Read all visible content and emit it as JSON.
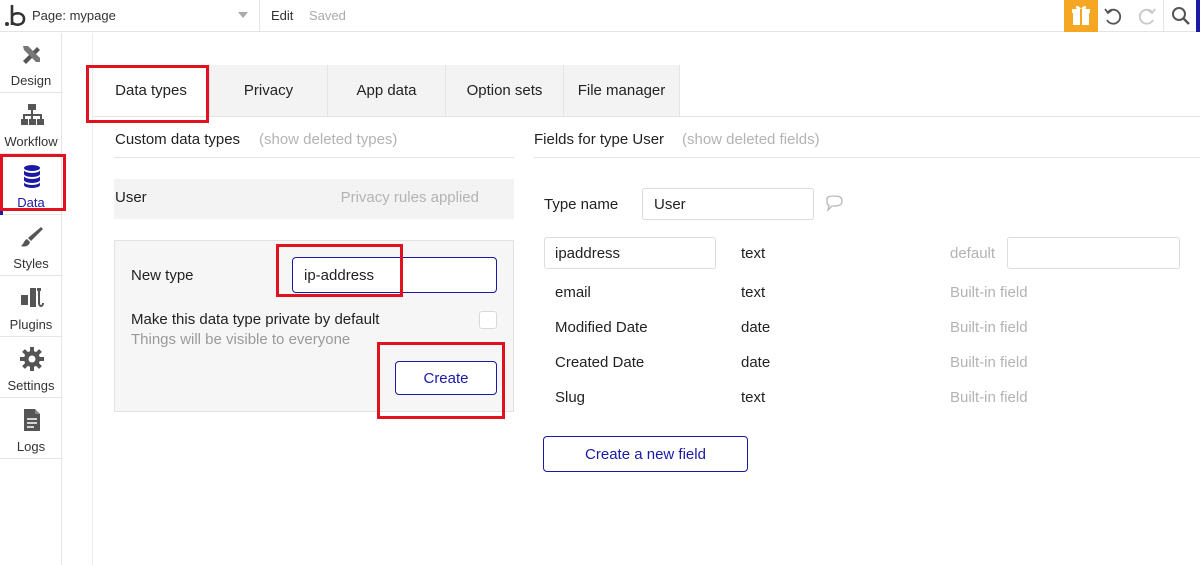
{
  "topbar": {
    "page_label": "Page: mypage",
    "edit_label": "Edit",
    "status": "Saved",
    "accent_color": "#f5a623",
    "brand_color": "#1a1aa6"
  },
  "sidebar": {
    "items": [
      {
        "label": "Design",
        "icon": "design-icon"
      },
      {
        "label": "Workflow",
        "icon": "workflow-icon"
      },
      {
        "label": "Data",
        "icon": "database-icon",
        "active": true
      },
      {
        "label": "Styles",
        "icon": "brush-icon"
      },
      {
        "label": "Plugins",
        "icon": "plug-icon"
      },
      {
        "label": "Settings",
        "icon": "gear-icon"
      },
      {
        "label": "Logs",
        "icon": "document-icon"
      }
    ]
  },
  "tabs": [
    {
      "label": "Data types",
      "active": true
    },
    {
      "label": "Privacy"
    },
    {
      "label": "App data"
    },
    {
      "label": "Option sets"
    },
    {
      "label": "File manager"
    }
  ],
  "custom_types": {
    "heading": "Custom data types",
    "show_deleted": "(show deleted types)",
    "types": [
      {
        "name": "User",
        "status": "Privacy rules applied"
      }
    ],
    "new_type": {
      "label": "New type",
      "value": "ip-address",
      "private_label": "Make this data type private by default",
      "private_hint": "Things will be visible to everyone",
      "private_checked": false,
      "create_label": "Create"
    }
  },
  "fields": {
    "heading": "Fields for type User",
    "show_deleted": "(show deleted fields)",
    "type_name_label": "Type name",
    "type_name_value": "User",
    "new_field": {
      "name": "ipaddress",
      "type": "text",
      "default_label": "default",
      "default_value": ""
    },
    "rows": [
      {
        "name": "email",
        "type": "text",
        "note": "Built-in field"
      },
      {
        "name": "Modified Date",
        "type": "date",
        "note": "Built-in field"
      },
      {
        "name": "Created Date",
        "type": "date",
        "note": "Built-in field"
      },
      {
        "name": "Slug",
        "type": "text",
        "note": "Built-in field"
      }
    ],
    "create_field_label": "Create a new field"
  },
  "highlight_color": "#e0121f"
}
